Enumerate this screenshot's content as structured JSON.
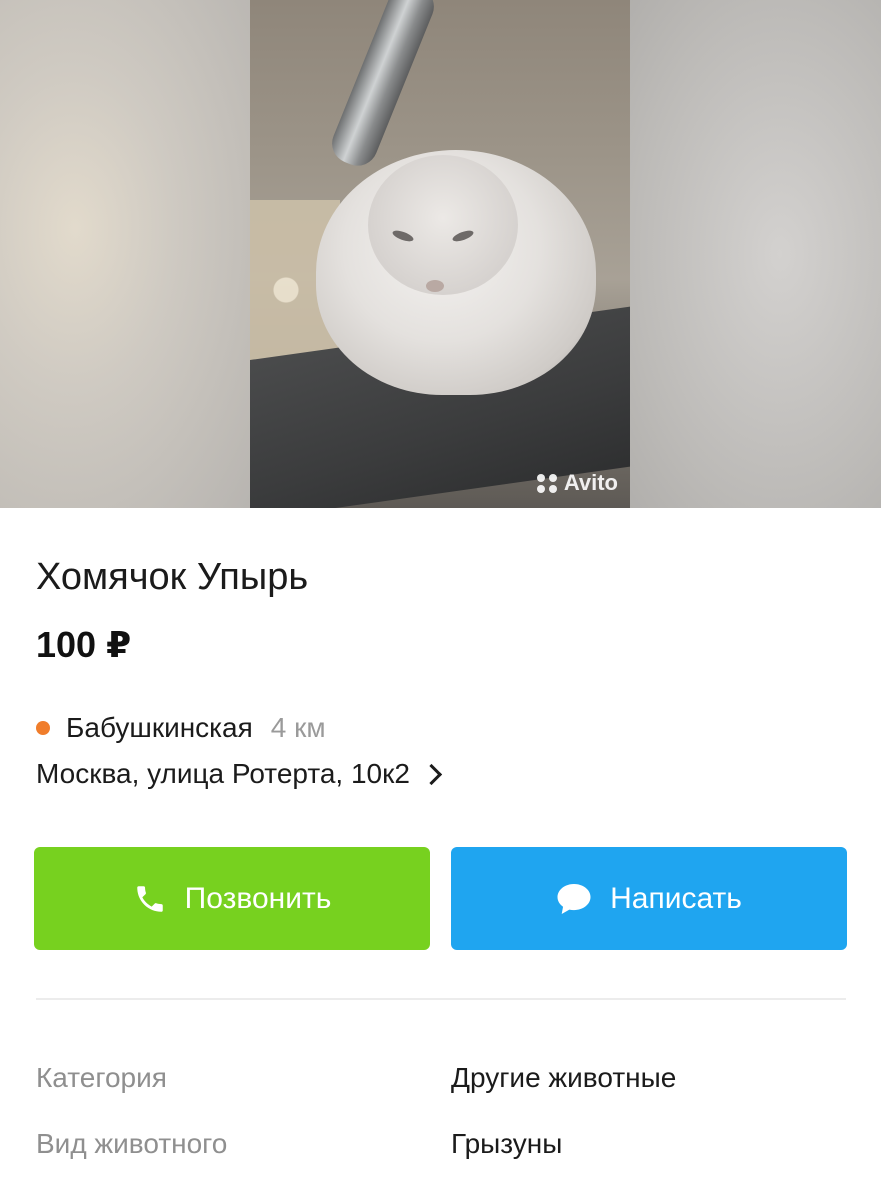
{
  "listing": {
    "title": "Хомячок Упырь",
    "price": "100 ₽",
    "watermark": "Avito"
  },
  "location": {
    "metro_station": "Бабушкинская",
    "metro_distance": "4 км",
    "metro_color": "#f07d2b",
    "address": "Москва, улица Ротерта, 10к2"
  },
  "actions": {
    "call_label": "Позвонить",
    "call_color": "#77d11f",
    "write_label": "Написать",
    "write_color": "#1fa5f0"
  },
  "params": [
    {
      "key": "Категория",
      "value": "Другие животные"
    },
    {
      "key": "Вид животного",
      "value": "Грызуны"
    }
  ],
  "icons": {
    "call": "phone-icon",
    "write": "chat-bubble-icon",
    "address": "chevron-right-icon"
  }
}
